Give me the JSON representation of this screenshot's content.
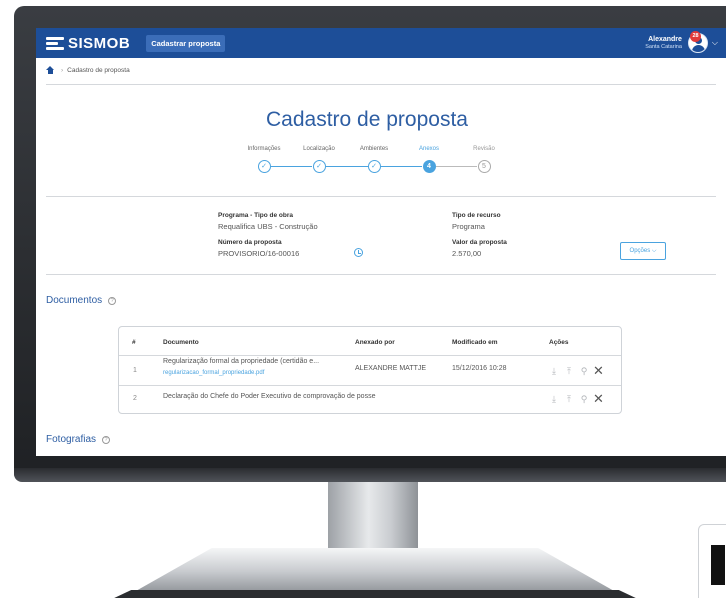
{
  "header": {
    "logo_text": "SISMOB",
    "nav_button": "Cadastrar proposta",
    "user_name": "Alexandre",
    "user_state": "Santa Catarina",
    "notification_count": "28"
  },
  "breadcrumb": {
    "current": "Cadastro de proposta"
  },
  "page_title": "Cadastro de proposta",
  "stepper": {
    "steps": [
      {
        "label": "Informações",
        "marker": "✓",
        "state": "done"
      },
      {
        "label": "Localização",
        "marker": "✓",
        "state": "done"
      },
      {
        "label": "Ambientes",
        "marker": "✓",
        "state": "done"
      },
      {
        "label": "Anexos",
        "marker": "4",
        "state": "active"
      },
      {
        "label": "Revisão",
        "marker": "5",
        "state": "future"
      }
    ]
  },
  "proposal_info": {
    "programa_label": "Programa - Tipo de obra",
    "programa_value": "Requalifica UBS - Construção",
    "numero_label": "Número da proposta",
    "numero_value": "PROVISORIO/16-00016",
    "tipo_recurso_label": "Tipo de recurso",
    "tipo_recurso_value": "Programa",
    "valor_label": "Valor da proposta",
    "valor_value": "2.570,00",
    "options_button": "Opções ⌵"
  },
  "documents": {
    "heading": "Documentos",
    "columns": [
      "#",
      "Documento",
      "Anexado por",
      "Modificado em",
      "Ações"
    ],
    "rows": [
      {
        "num": "1",
        "document": "Regularização formal da propriedade (certidão e...",
        "file": "regularizacao_formal_propriedade.pdf",
        "attached_by": "ALEXANDRE MATTJE",
        "modified": "15/12/2016 10:28"
      },
      {
        "num": "2",
        "document": "Declaração do Chefe do Poder Executivo de comprovação de posse",
        "file": "",
        "attached_by": "",
        "modified": ""
      }
    ]
  },
  "photos": {
    "heading": "Fotografias"
  },
  "colors": {
    "header_blue": "#1d4e98",
    "accent_blue": "#4aa3df",
    "title_blue": "#2e5ea3",
    "badge_red": "#e03a3a"
  }
}
